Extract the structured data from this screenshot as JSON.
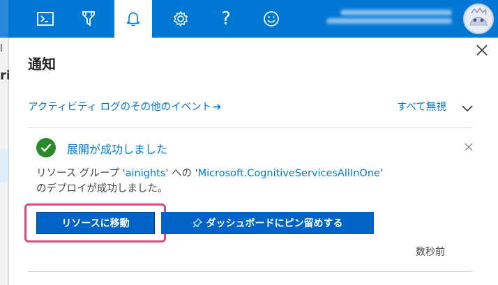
{
  "topbar": {
    "icons": [
      "cloud-shell-icon",
      "directory-filter-icon",
      "bell-icon",
      "gear-icon",
      "help-icon",
      "smiley-icon"
    ],
    "active": "bell-icon"
  },
  "background": {
    "char1": "l",
    "char2": "ri"
  },
  "panel": {
    "title": "通知",
    "activity_link": "アクティビティ ログのその他のイベント",
    "activity_arrow": "➔",
    "dismiss_all": "すべて無視"
  },
  "notification": {
    "title": "展開が成功しました",
    "msg_prefix": "リソース グループ '",
    "resource_group": "ainights",
    "msg_mid": "' への '",
    "service": "Microsoft.CognitiveServicesAllInOne",
    "msg_suffix": "'",
    "msg_line2": "のデプロイが成功しました。",
    "go_to_resource": "リソースに移動",
    "pin_icon": "☆",
    "pin_to_dashboard": "ダッシュボードにピン留めする",
    "timestamp": "数秒前"
  },
  "colors": {
    "accent": "#0078d4",
    "button": "#0064c6",
    "success": "#2a8a2a",
    "highlight_ring": "#e04a7a"
  }
}
